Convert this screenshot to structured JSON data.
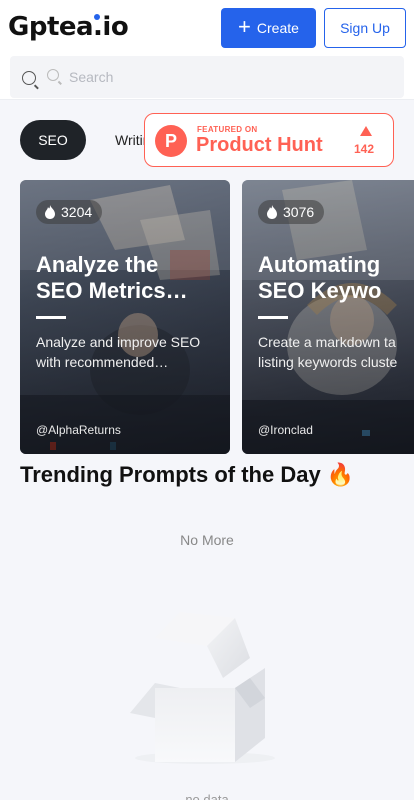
{
  "header": {
    "logo_text": "Gptea.io",
    "create_label": "Create",
    "signup_label": "Sign Up",
    "accent_color": "#2563eb"
  },
  "search": {
    "placeholder": "Search"
  },
  "tabs": [
    {
      "label": "SEO",
      "active": true
    },
    {
      "label": "Writing",
      "active": false
    }
  ],
  "product_hunt": {
    "logo_letter": "P",
    "featured_label": "FEATURED ON",
    "name": "Product Hunt",
    "upvotes": "142",
    "color": "#ff6154"
  },
  "cards": [
    {
      "views": "3204",
      "title_lines": [
        "Analyze the",
        "SEO Metrics…"
      ],
      "desc_lines": [
        "Analyze and improve SEO",
        "with recommended…"
      ],
      "author": "@AlphaReturns"
    },
    {
      "views": "3076",
      "title_lines": [
        "Automating",
        "SEO Keywo"
      ],
      "desc_lines": [
        "Create a markdown ta",
        "listing keywords cluste"
      ],
      "author": "@Ironclad"
    }
  ],
  "trending_heading": "Trending Prompts of the Day 🔥",
  "no_more": "No More",
  "empty_text": "no data"
}
